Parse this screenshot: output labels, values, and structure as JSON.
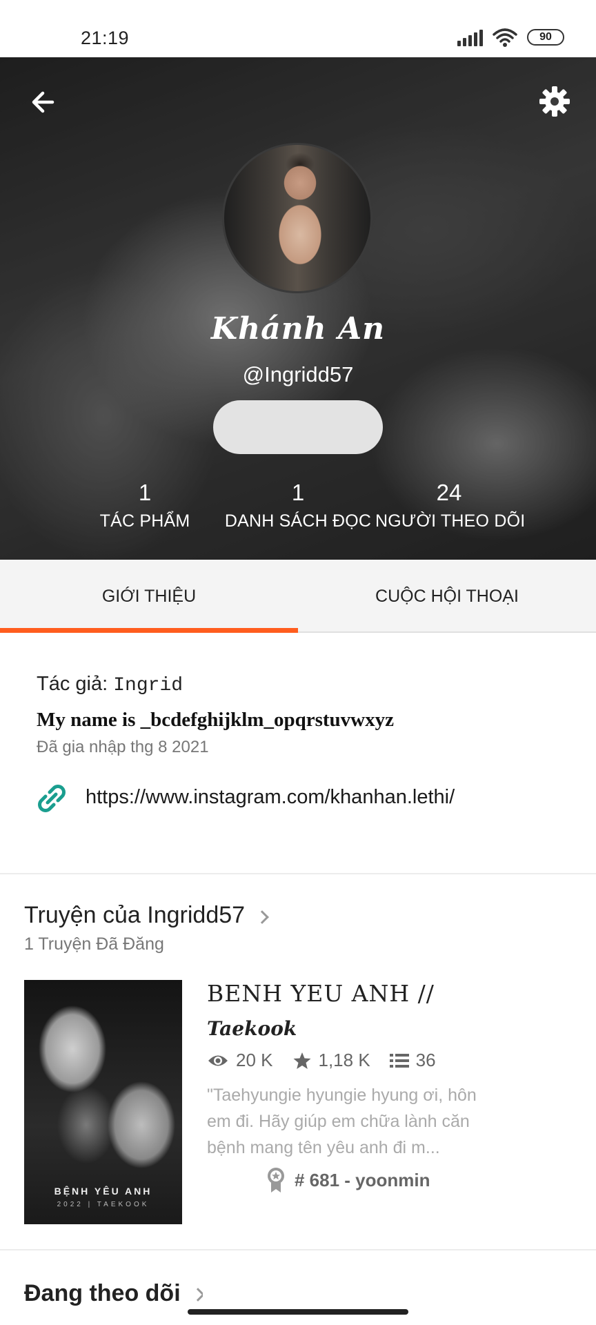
{
  "status_bar": {
    "time": "21:19",
    "battery": "90"
  },
  "profile": {
    "display_name": "Khánh An",
    "username": "@Ingridd57",
    "stats": [
      {
        "value": "1",
        "label": "TÁC PHẨM"
      },
      {
        "value": "1",
        "label": "DANH SÁCH ĐỌC"
      },
      {
        "value": "24",
        "label": "NGƯỜI THEO DÕI"
      }
    ]
  },
  "tabs": [
    {
      "label": "GIỚI THIỆU",
      "active": true
    },
    {
      "label": "CUỘC HỘI THOẠI",
      "active": false
    }
  ],
  "about": {
    "author_prefix": "Tác giả:",
    "author_name": "Ingrid",
    "bio": "My name is _bcdefghijklm_opqrstuvwxyz",
    "joined": "Đã gia nhập thg 8 2021",
    "link": "https://www.instagram.com/khanhan.lethi/"
  },
  "stories_section": {
    "title": "Truyện của Ingridd57",
    "subtitle": "1 Truyện Đã Đăng",
    "story": {
      "title_line1": "BENH YEU ANH //",
      "title_line2": "Taekook",
      "views": "20 K",
      "votes": "1,18 K",
      "parts": "36",
      "description": "\"Taehyungie hyungie hyung ơi, hôn em đi. Hãy giúp em chữa lành căn bệnh mang tên yêu anh đi m...",
      "rank": "# 681 - yoonmin",
      "cover_title": "BỆNH YÊU ANH",
      "cover_subtitle": "2022 | TAEKOOK"
    }
  },
  "following_section": {
    "title": "Đang theo dõi"
  },
  "colors": {
    "accent": "#ff5d1e",
    "link_icon": "#1a9e8f"
  },
  "icons": {
    "back": "arrow-left-icon",
    "settings": "gear-icon",
    "link": "link-icon",
    "views": "eye-icon",
    "votes": "star-icon",
    "parts": "list-icon",
    "rank": "ribbon-icon"
  }
}
